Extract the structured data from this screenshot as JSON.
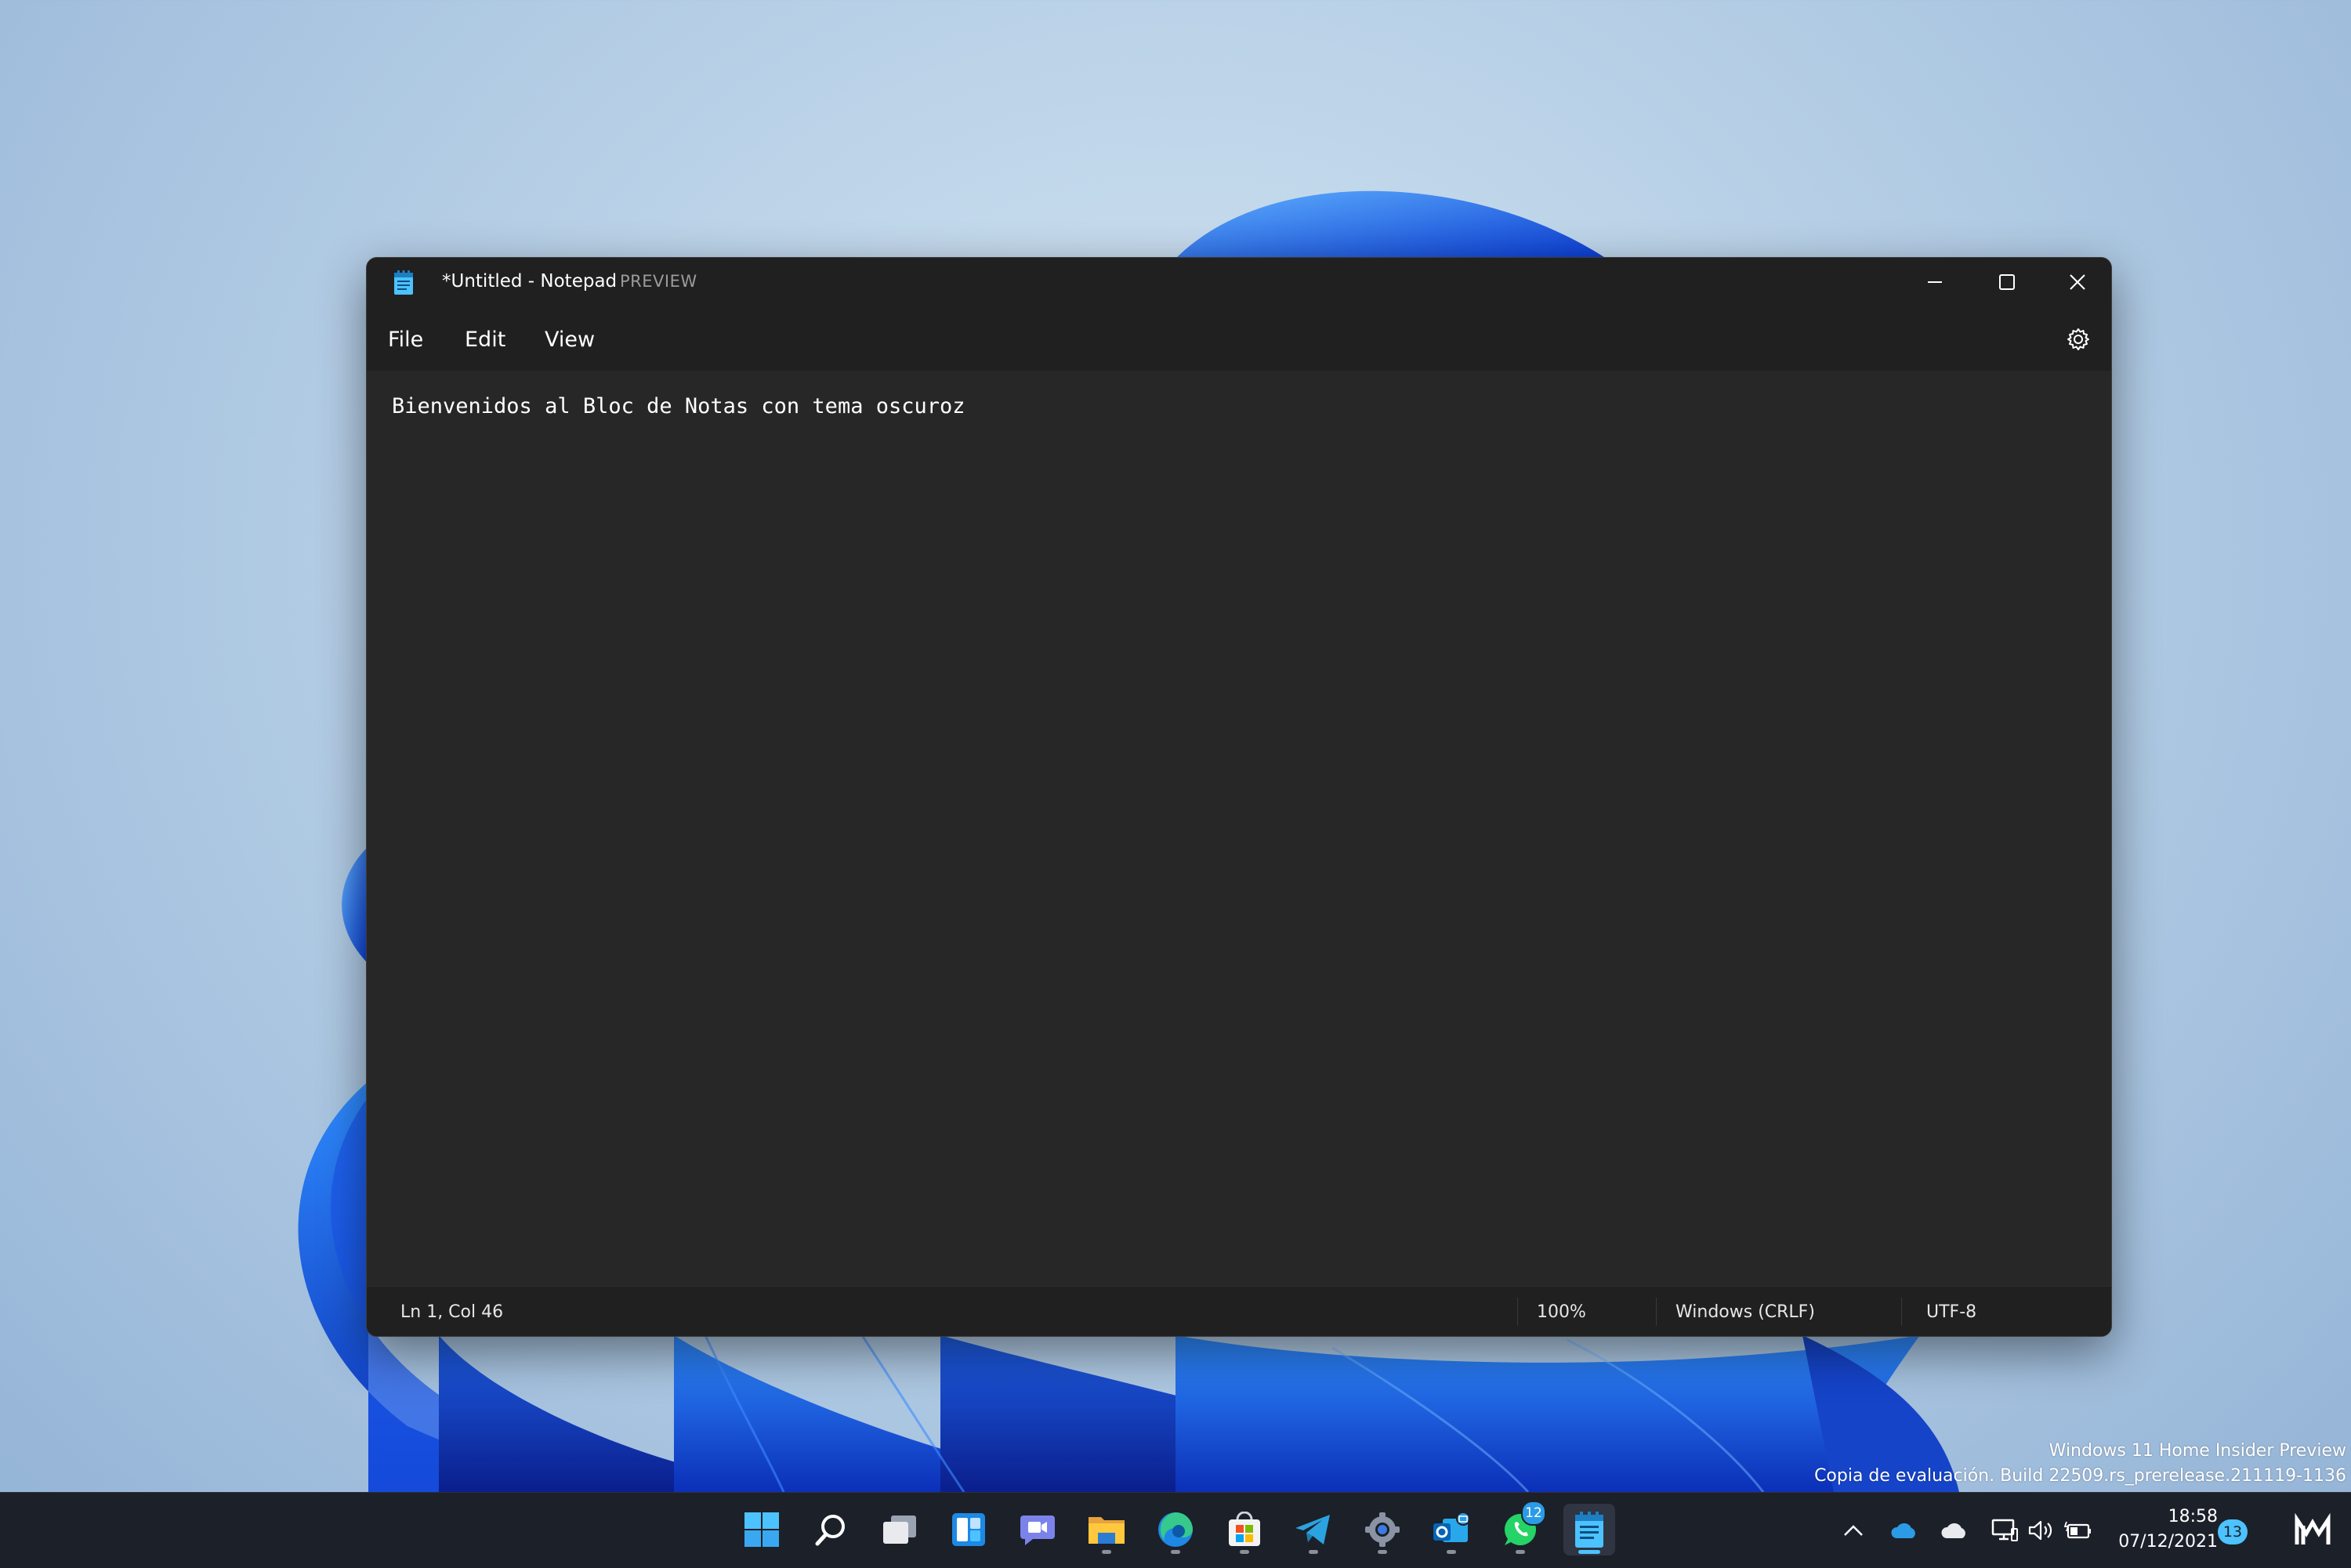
{
  "window": {
    "title": "*Untitled - Notepad",
    "badge": "PREVIEW",
    "menu": {
      "file": "File",
      "edit": "Edit",
      "view": "View"
    },
    "icons": {
      "app": "notepad-icon",
      "minimize": "minimize-icon",
      "maximize": "maximize-icon",
      "close": "close-icon",
      "settings": "gear-icon"
    }
  },
  "editor": {
    "content": "Bienvenidos al Bloc de Notas con tema oscuroz"
  },
  "status": {
    "position": "Ln 1, Col 46",
    "zoom": "100%",
    "line_ending": "Windows (CRLF)",
    "encoding": "UTF-8"
  },
  "watermark": {
    "line1": "Windows 11 Home Insider Preview",
    "line2": "Copia de evaluación. Build 22509.rs_prerelease.211119-1136"
  },
  "taskbar": {
    "apps": [
      {
        "icon": "start-icon",
        "running": false
      },
      {
        "icon": "search-icon",
        "running": false
      },
      {
        "icon": "task-view-icon",
        "running": false
      },
      {
        "icon": "widgets-icon",
        "running": false
      },
      {
        "icon": "chat-icon",
        "running": false
      },
      {
        "icon": "file-explorer-icon",
        "running": true
      },
      {
        "icon": "edge-icon",
        "running": true
      },
      {
        "icon": "store-icon",
        "running": true
      },
      {
        "icon": "telegram-icon",
        "running": true
      },
      {
        "icon": "settings-icon",
        "running": true
      },
      {
        "icon": "outlook-icon",
        "running": true
      },
      {
        "icon": "whatsapp-icon",
        "running": true,
        "badge": "12"
      },
      {
        "icon": "notepad-icon",
        "running": true,
        "active": true
      }
    ],
    "tray": {
      "icons": [
        "chevron-up-icon",
        "onedrive-icon",
        "cloud-icon",
        "network-icon",
        "volume-icon",
        "battery-icon"
      ],
      "time": "18:58",
      "date": "07/12/2021",
      "notification_count": "13"
    }
  },
  "colors": {
    "window_bg": "#202020",
    "editor_bg": "#272727",
    "accent": "#4cc2ff",
    "taskbar_bg": "#1c2029"
  }
}
